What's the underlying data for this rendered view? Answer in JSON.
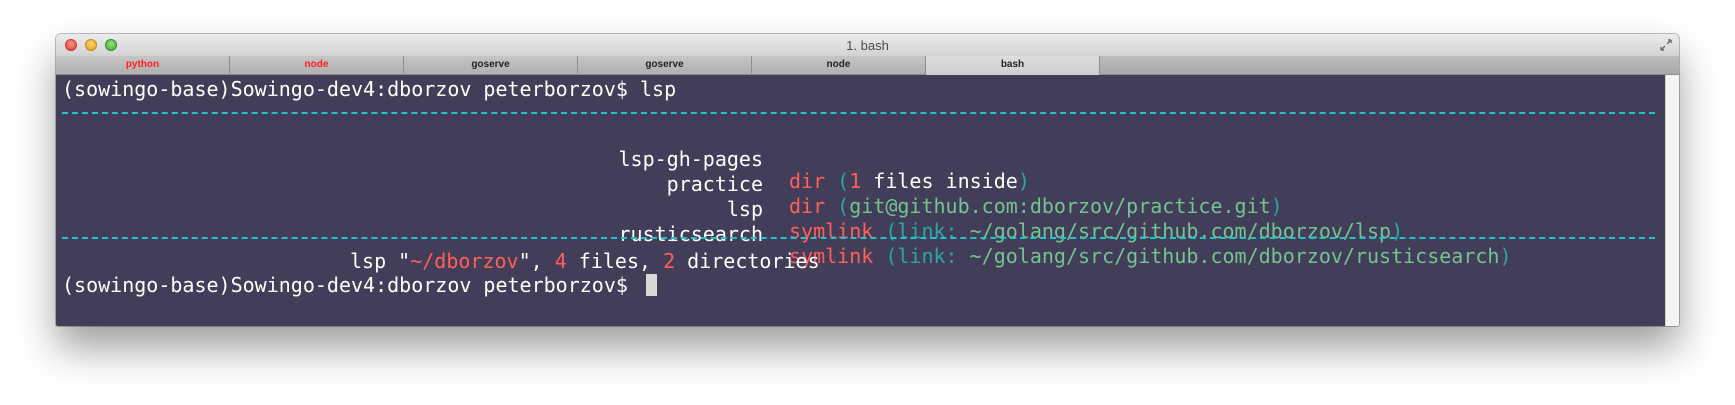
{
  "window": {
    "title": "1. bash"
  },
  "tabs": [
    {
      "label": "python"
    },
    {
      "label": "node"
    },
    {
      "label": "goserve"
    },
    {
      "label": "goserve"
    },
    {
      "label": "node"
    },
    {
      "label": "bash"
    }
  ],
  "terminal": {
    "prompt": "(sowingo-base)Sowingo-dev4:dborzov peterborzov$",
    "command": "lsp",
    "entries": [
      {
        "name": "lsp-gh-pages",
        "kind": "dir",
        "open": " (",
        "detail_label": "",
        "detail_num": "1",
        "detail_rest": " files inside",
        "close": ")"
      },
      {
        "name": "practice",
        "kind": "dir",
        "open": " (",
        "detail_label": "",
        "detail_num": "",
        "detail_rest": "git@github.com:dborzov/practice.git",
        "close": ")"
      },
      {
        "name": "lsp",
        "kind": "symlink",
        "open": " (",
        "detail_label": "link: ",
        "detail_num": "",
        "detail_rest": "~/golang/src/github.com/dborzov/lsp",
        "close": ")"
      },
      {
        "name": "rusticsearch",
        "kind": "symlink",
        "open": " (",
        "detail_label": "link: ",
        "detail_num": "",
        "detail_rest": "~/golang/src/github.com/dborzov/rusticsearch",
        "close": ")"
      }
    ],
    "summary": {
      "prefix": "lsp \"",
      "path": "~/dborzov",
      "mid": "\", ",
      "files": "4",
      "files_label": " files, ",
      "dirs": "2",
      "dirs_label": " directories"
    }
  },
  "colors": {
    "background": "#423e59",
    "accent_red": "#ff5f57",
    "accent_teal": "#29a8a3",
    "accent_green": "#73c48f",
    "dash": "#22c2c8"
  }
}
